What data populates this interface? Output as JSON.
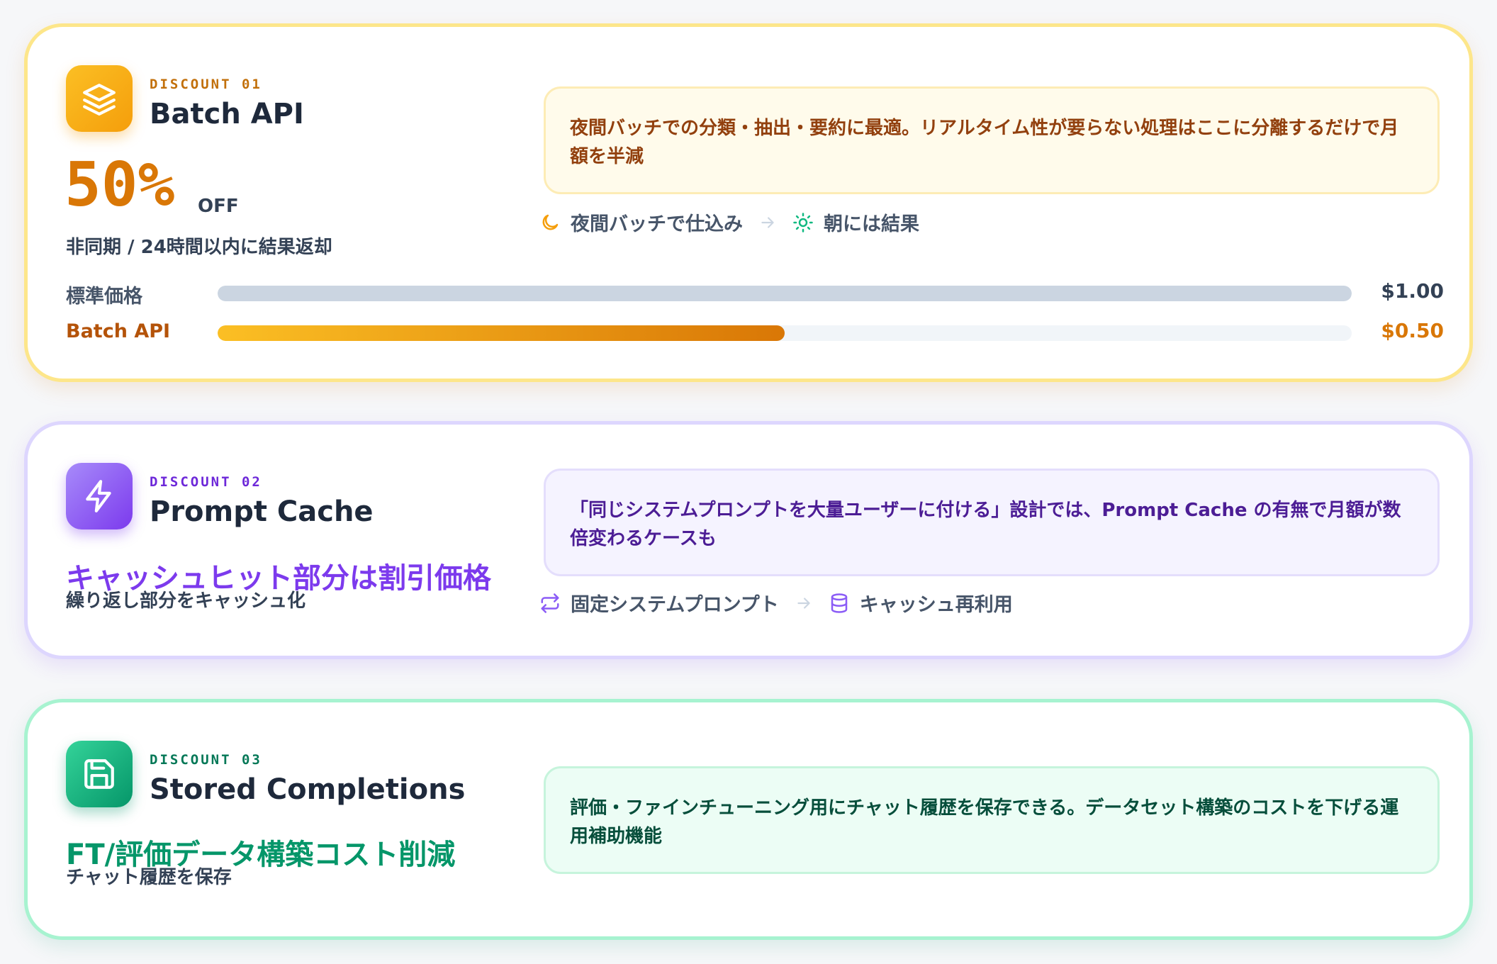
{
  "cards": [
    {
      "eyebrow": "DISCOUNT 01",
      "title": "Batch API",
      "icon": "layers-icon",
      "accent": "#d97706",
      "discount": "50%",
      "discount_suffix": "OFF",
      "subtitle": "非同期 / 24時間以内に結果返却",
      "note": "夜間バッチでの分類・抽出・要約に最適。リアルタイム性が要らない処理はここに分離するだけで月額を半減",
      "flow": [
        {
          "icon": "moon-icon",
          "label": "夜間バッチで仕込み"
        },
        {
          "icon": "sun-icon",
          "label": "朝には結果"
        }
      ],
      "price_bars": [
        {
          "label": "標準価格",
          "price": "$1.00",
          "fraction": 1.0
        },
        {
          "label": "Batch API",
          "price": "$0.50",
          "fraction": 0.5
        }
      ]
    },
    {
      "eyebrow": "DISCOUNT 02",
      "title": "Prompt Cache",
      "icon": "zap-icon",
      "accent": "#7c3aed",
      "headline": "キャッシュヒット部分は割引価格",
      "subtitle": "繰り返し部分をキャッシュ化",
      "note": "「同じシステムプロンプトを大量ユーザーに付ける」設計では、Prompt Cache の有無で月額が数倍変わるケースも",
      "flow": [
        {
          "icon": "repeat-icon",
          "label": "固定システムプロンプト"
        },
        {
          "icon": "database-icon",
          "label": "キャッシュ再利用"
        }
      ]
    },
    {
      "eyebrow": "DISCOUNT 03",
      "title": "Stored Completions",
      "icon": "save-icon",
      "accent": "#059669",
      "headline": "FT/評価データ構築コスト削減",
      "subtitle": "チャット履歴を保存",
      "note": "評価・ファインチューニング用にチャット履歴を保存できる。データセット構築のコストを下げる運用補助機能"
    }
  ]
}
